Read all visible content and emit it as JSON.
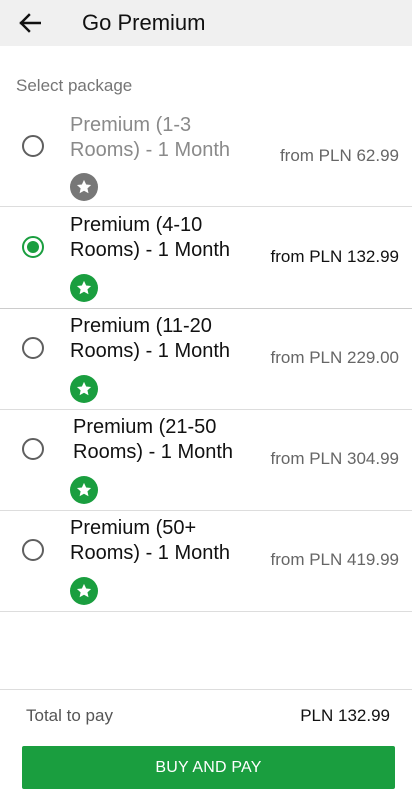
{
  "appbar": {
    "title": "Go Premium",
    "back_icon": "arrow-left-icon"
  },
  "section_label": "Select package",
  "packages": [
    {
      "name_line1": "Premium (1-3",
      "name_line2": "Rooms) - 1 Month",
      "price": "from PLN 62.99",
      "selected": false,
      "enabled": false
    },
    {
      "name_line1": "Premium (4-10",
      "name_line2": "Rooms) - 1 Month",
      "price": "from PLN 132.99",
      "selected": true,
      "enabled": true
    },
    {
      "name_line1": "Premium (11-20",
      "name_line2": "Rooms) - 1 Month",
      "price": "from PLN 229.00",
      "selected": false,
      "enabled": true
    },
    {
      "name_line1": "Premium (21-50",
      "name_line2": "Rooms) - 1 Month",
      "price": "from PLN 304.99",
      "selected": false,
      "enabled": true
    },
    {
      "name_line1": "Premium (50+",
      "name_line2": "Rooms) - 1 Month",
      "price": "from PLN 419.99",
      "selected": false,
      "enabled": true
    }
  ],
  "footer": {
    "total_label": "Total to pay",
    "total_value": "PLN 132.99",
    "buy_label": "BUY AND PAY"
  },
  "colors": {
    "accent": "#1a9e3f",
    "appbar_bg": "#f0f0f0",
    "disabled_star": "#777777"
  }
}
